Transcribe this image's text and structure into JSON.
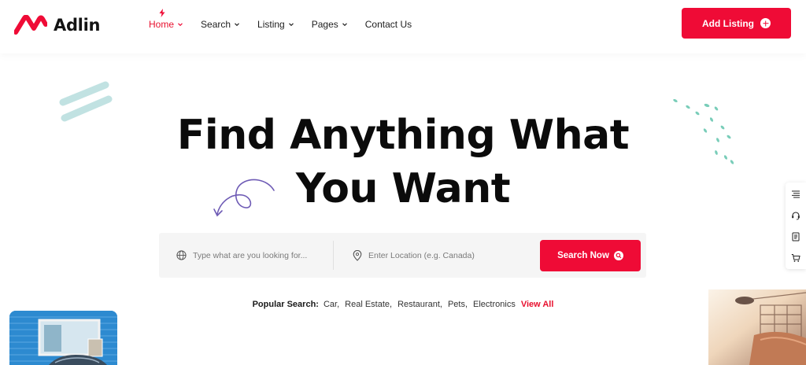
{
  "brand": {
    "name": "Adlin",
    "accent": "#ef0b36"
  },
  "nav": {
    "items": [
      {
        "label": "Home",
        "active": true,
        "has_dropdown": true
      },
      {
        "label": "Search",
        "active": false,
        "has_dropdown": true
      },
      {
        "label": "Listing",
        "active": false,
        "has_dropdown": true
      },
      {
        "label": "Pages",
        "active": false,
        "has_dropdown": true
      },
      {
        "label": "Contact Us",
        "active": false,
        "has_dropdown": false
      }
    ],
    "add_listing": "Add Listing"
  },
  "hero": {
    "title_line1": "Find Anything What",
    "title_line2": "You Want"
  },
  "search": {
    "what_placeholder": "Type what are you looking for...",
    "location_placeholder": "Enter Location (e.g. Canada)",
    "button": "Search Now"
  },
  "popular": {
    "label": "Popular Search:",
    "tags": [
      "Car,",
      "Real Estate,",
      "Restaurant,",
      "Pets,",
      "Electronics"
    ],
    "view_all": "View All"
  },
  "side_tools": [
    "list-icon",
    "support-icon",
    "document-icon",
    "cart-icon"
  ]
}
